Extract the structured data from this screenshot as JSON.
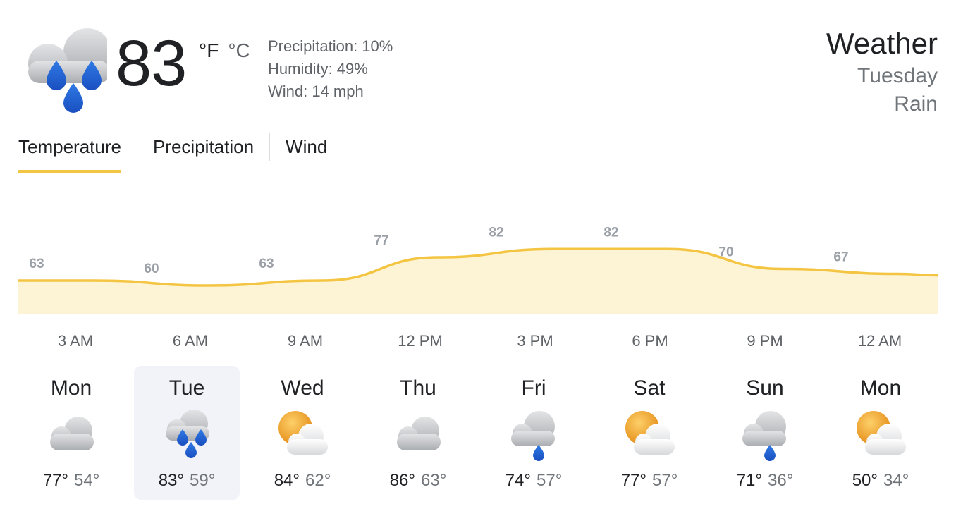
{
  "current": {
    "temperature": "83",
    "unit_f": "°F",
    "unit_c": "°C",
    "precipitation": "Precipitation: 10%",
    "humidity": "Humidity: 49%",
    "wind": "Wind: 14 mph",
    "icon": "rain-icon"
  },
  "heading": {
    "title": "Weather",
    "day": "Tuesday",
    "condition": "Rain"
  },
  "tabs": [
    {
      "label": "Temperature",
      "active": true
    },
    {
      "label": "Precipitation",
      "active": false
    },
    {
      "label": "Wind",
      "active": false
    }
  ],
  "colors": {
    "accent": "#f4c542",
    "chart_line": "#f4c542",
    "chart_fill": "#fdf4d6",
    "rain_drop": "#1a5fd0",
    "cloud": "#bfc2c6",
    "sun": "#f09a1f",
    "selected_day_bg": "#f1f3f8"
  },
  "chart_data": {
    "type": "area",
    "x": [
      "3 AM",
      "6 AM",
      "9 AM",
      "12 PM",
      "3 PM",
      "6 PM",
      "9 PM",
      "12 AM"
    ],
    "values": [
      63,
      60,
      63,
      77,
      82,
      82,
      70,
      67
    ],
    "labels": [
      "63",
      "60",
      "63",
      "77",
      "82",
      "82",
      "70",
      "67"
    ]
  },
  "hours": [
    "3 AM",
    "6 AM",
    "9 AM",
    "12 PM",
    "3 PM",
    "6 PM",
    "9 PM",
    "12 AM"
  ],
  "days": [
    {
      "name": "Mon",
      "high": "77°",
      "low": "54°",
      "icon": "cloudy-icon",
      "selected": false
    },
    {
      "name": "Tue",
      "high": "83°",
      "low": "59°",
      "icon": "rain-icon",
      "selected": true
    },
    {
      "name": "Wed",
      "high": "84°",
      "low": "62°",
      "icon": "partly-cloudy-icon",
      "selected": false
    },
    {
      "name": "Thu",
      "high": "86°",
      "low": "63°",
      "icon": "cloudy-icon",
      "selected": false
    },
    {
      "name": "Fri",
      "high": "74°",
      "low": "57°",
      "icon": "showers-icon",
      "selected": false
    },
    {
      "name": "Sat",
      "high": "77°",
      "low": "57°",
      "icon": "partly-cloudy-icon",
      "selected": false
    },
    {
      "name": "Sun",
      "high": "71°",
      "low": "36°",
      "icon": "showers-icon",
      "selected": false
    },
    {
      "name": "Mon",
      "high": "50°",
      "low": "34°",
      "icon": "partly-cloudy-icon",
      "selected": false
    }
  ]
}
